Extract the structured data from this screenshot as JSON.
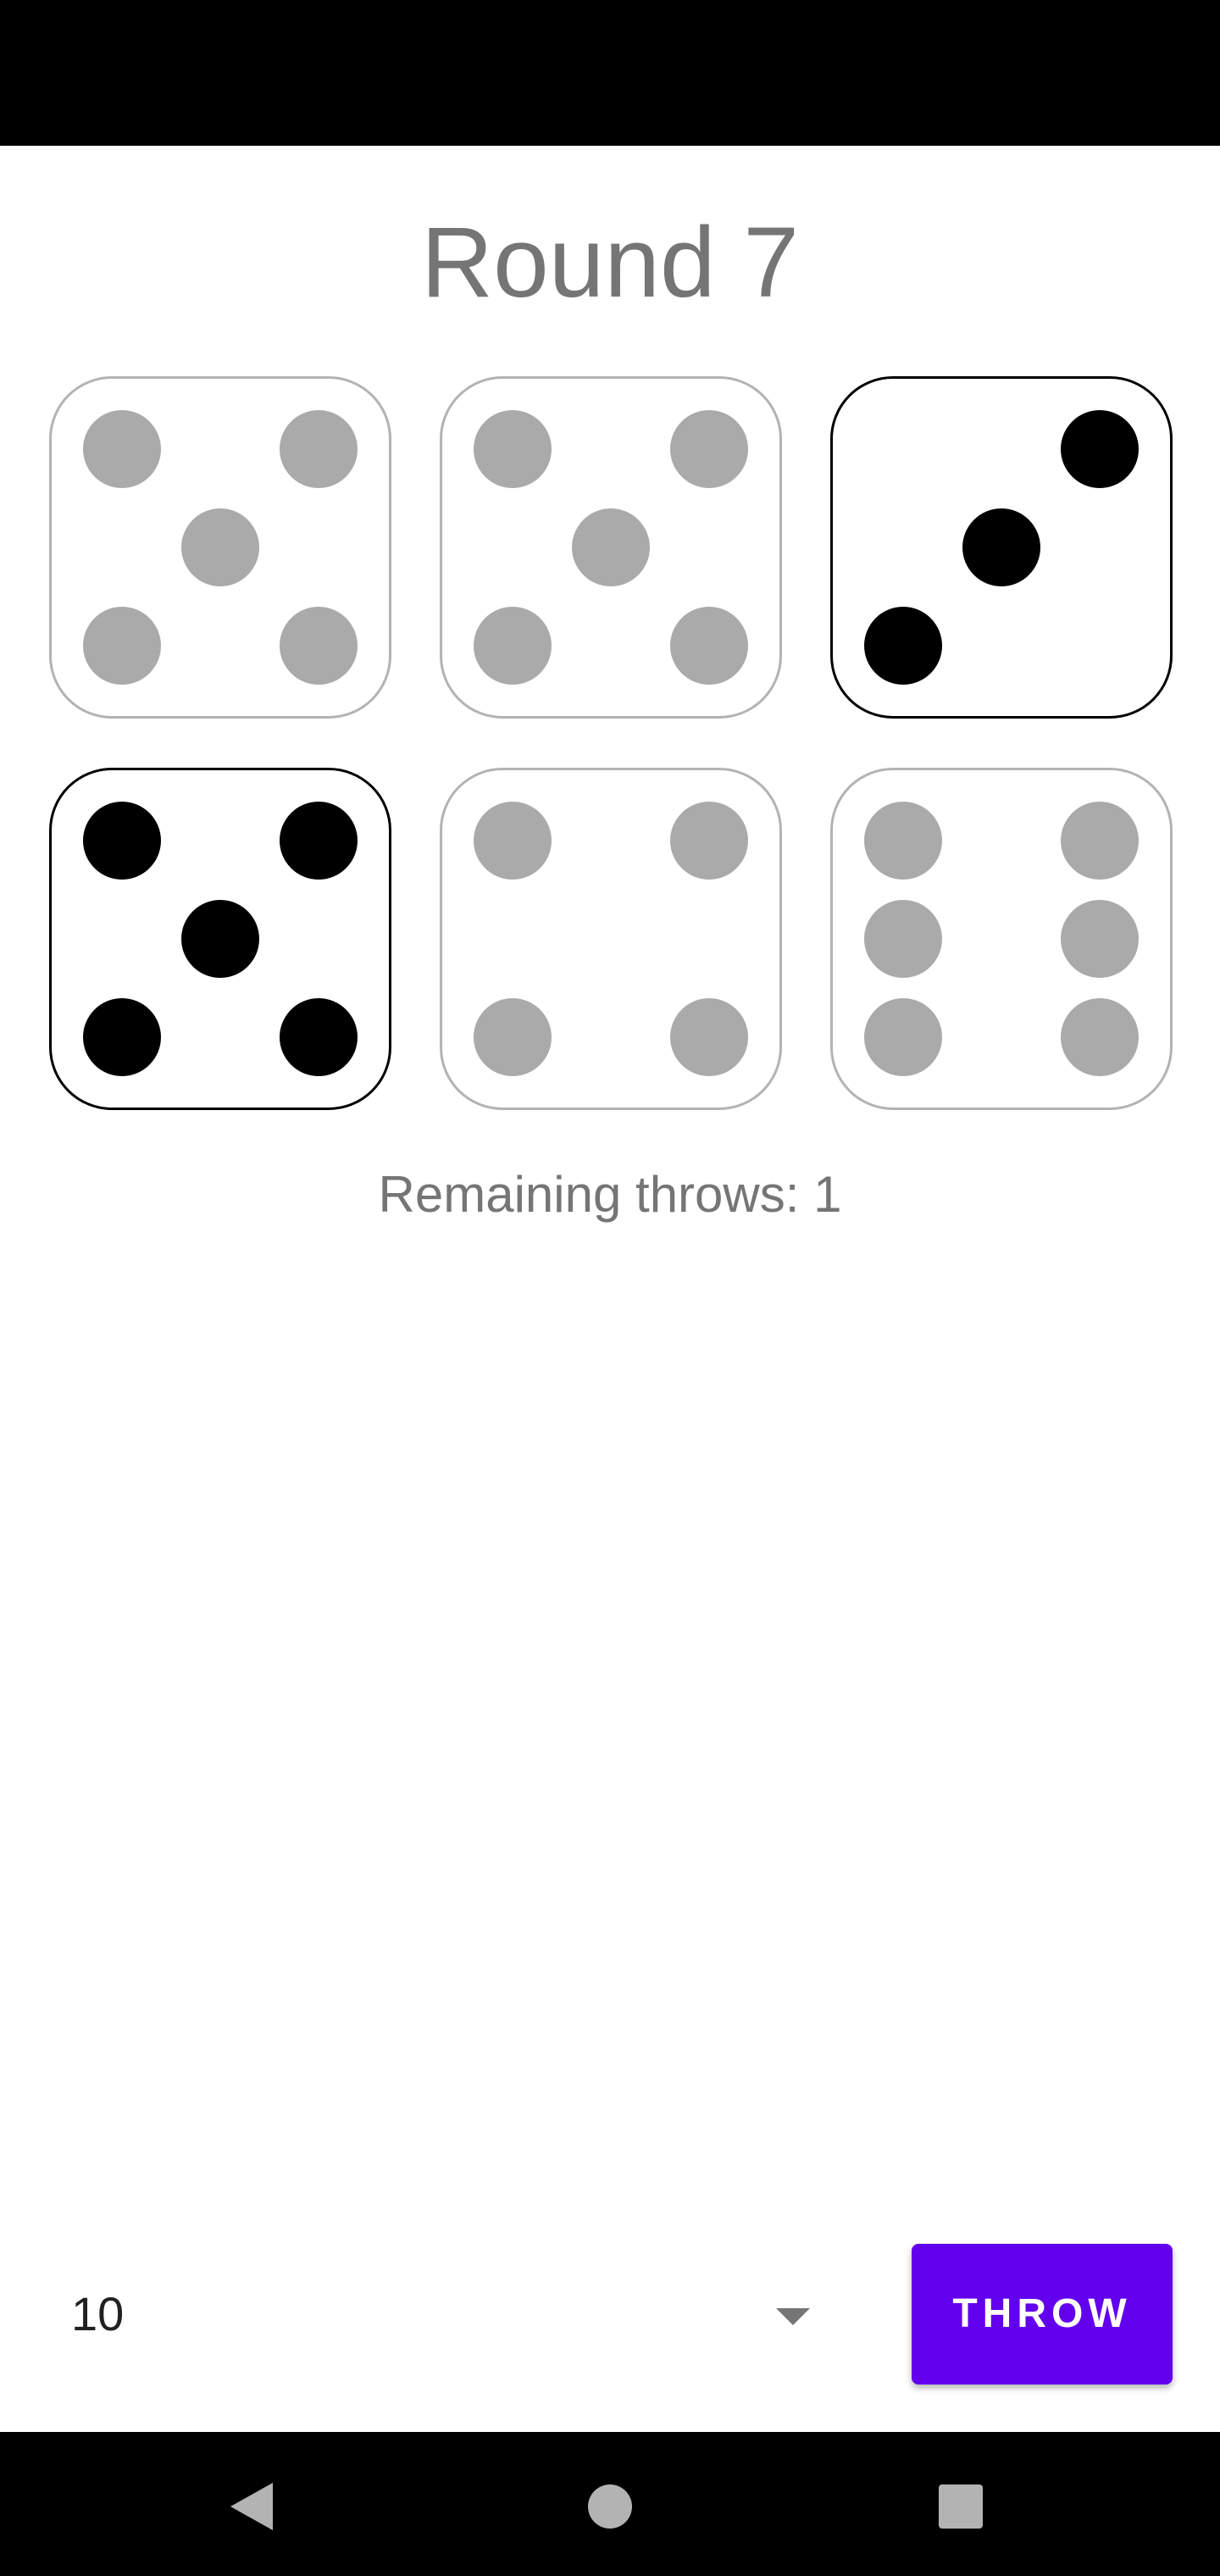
{
  "header": {
    "title": "Round 7"
  },
  "dice": [
    {
      "value": 5,
      "held": false
    },
    {
      "value": 5,
      "held": false
    },
    {
      "value": 3,
      "held": true
    },
    {
      "value": 5,
      "held": true
    },
    {
      "value": 4,
      "held": false
    },
    {
      "value": 6,
      "held": false
    }
  ],
  "status": {
    "remaining_throws": "Remaining throws: 1"
  },
  "controls": {
    "selected_option": "10",
    "throw_label": "THROW"
  },
  "colors": {
    "accent": "#6200ee",
    "held_pip": "#000000",
    "free_pip": "#aaaaaa",
    "free_border": "#b3b3b3",
    "text_gray": "#757575"
  },
  "navigation": {
    "back_icon": "back-icon",
    "home_icon": "home-icon",
    "recents_icon": "recents-icon"
  }
}
